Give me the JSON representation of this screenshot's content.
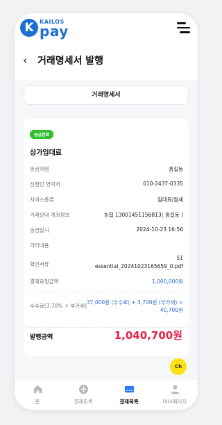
{
  "topbar": {
    "logo_mark": "K",
    "brand_small": "KAILOS",
    "brand_big": "pay"
  },
  "header": {
    "back_glyph": "‹",
    "title": "거래명세서 발행"
  },
  "tab": {
    "label": "거래명세서"
  },
  "card": {
    "badge": "송금완료",
    "product": "상가임대료",
    "rows": [
      {
        "label": "송금자명",
        "value": "홍길동"
      },
      {
        "label": "신청인 연락처",
        "value": "010-2437-0335"
      },
      {
        "label": "서비스종류",
        "value": "임대료/월세"
      },
      {
        "label": "거래상대 계좌정보",
        "value": "농협 13001451156813( 홍길동 )"
      },
      {
        "label": "송금일시",
        "value": "2024-10-23 16:56"
      },
      {
        "label": "기타내용",
        "value": ""
      },
      {
        "label": "확인서류",
        "value_line1": "51",
        "value_line2": "essential_20241023165659_0.pdf"
      },
      {
        "label": "결제요청금액",
        "value": "1,000,000원"
      }
    ],
    "fee": {
      "label": "수수료(3.70% + 부가세)",
      "line1": "37,000원 (수수료) + 3,700원 (부가세) =",
      "line2": "40,700원"
    },
    "issue": {
      "label": "발행금액",
      "value": "1,040,700원"
    }
  },
  "kakao": {
    "label": "Ch"
  },
  "nav": [
    {
      "label": "홈",
      "icon": "home-icon",
      "active": false
    },
    {
      "label": "결제등록",
      "icon": "plus-circle-icon",
      "active": false
    },
    {
      "label": "결제목록",
      "icon": "card-list-icon",
      "active": true
    },
    {
      "label": "마이페이지",
      "icon": "user-icon",
      "active": false
    }
  ],
  "colors": {
    "brand": "#1d6fd2",
    "badge": "#2fbf2f",
    "amount_blue": "#2b6bd6",
    "issue_red": "#e8234a",
    "kakao_yellow": "#fbe214",
    "nav_active_icon": "#2979ff"
  }
}
